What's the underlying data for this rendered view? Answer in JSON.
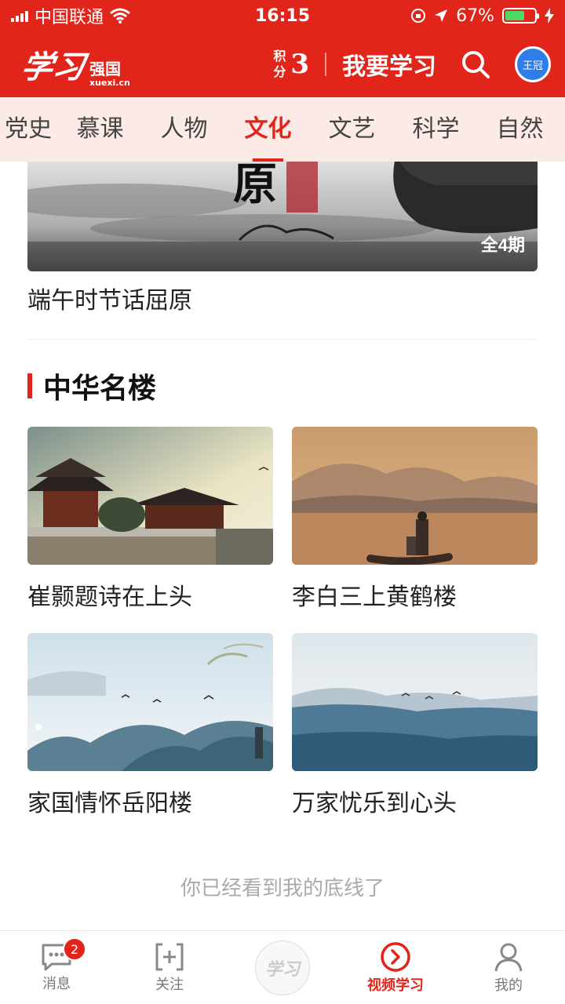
{
  "status_bar": {
    "carrier": "中国联通",
    "time": "16:15",
    "battery_percent": "67%",
    "battery_level": 0.67,
    "icons": [
      "signal-icon",
      "wifi-icon",
      "orientation-lock-icon",
      "location-icon",
      "battery-icon",
      "charging-icon"
    ]
  },
  "header": {
    "logo_script": "学习",
    "logo_name": "强国",
    "logo_url": "xuexi.cn",
    "points_label_top": "积",
    "points_label_bottom": "分",
    "points_value": "3",
    "study_label": "我要学习",
    "avatar_text": "王冠",
    "brand_color": "#e2251b"
  },
  "tabs": [
    {
      "label": "党史"
    },
    {
      "label": "慕课"
    },
    {
      "label": "人物"
    },
    {
      "label": "文化"
    },
    {
      "label": "文艺"
    },
    {
      "label": "科学"
    },
    {
      "label": "自然"
    }
  ],
  "active_tab": "文化",
  "hero": {
    "overlay_char": "原",
    "badge": "全4期",
    "title": "端午时节话屈原"
  },
  "section": {
    "title": "中华名楼",
    "items": [
      {
        "caption": "崔颢题诗在上头"
      },
      {
        "caption": "李白三上黄鹤楼"
      },
      {
        "caption": "家国情怀岳阳楼"
      },
      {
        "caption": "万家忧乐到心头"
      }
    ]
  },
  "end_note": "你已经看到我的底线了",
  "bottom_nav": {
    "items": [
      {
        "label": "消息",
        "badge": "2"
      },
      {
        "label": "关注"
      },
      {
        "label": "学习"
      },
      {
        "label": "视频学习"
      },
      {
        "label": "我的"
      }
    ],
    "active": "视频学习"
  }
}
